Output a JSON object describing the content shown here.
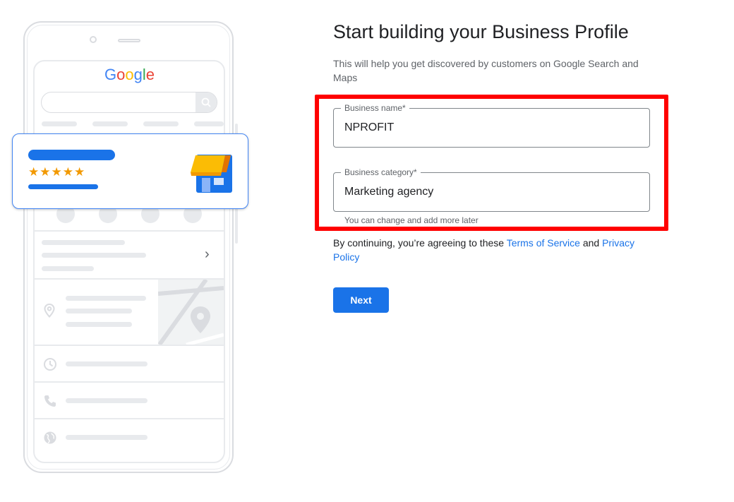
{
  "illustration": {
    "logo_text": "Google",
    "logo_colors": [
      "#4285f4",
      "#ea4335",
      "#fbbc05",
      "#4285f4",
      "#34a853",
      "#ea4335"
    ],
    "stars": "★★★★★",
    "rating_stars": 5,
    "chevron": "›"
  },
  "form": {
    "title": "Start building your Business Profile",
    "subtitle": "This will help you get discovered by customers on Google Search and Maps",
    "business_name": {
      "label": "Business name*",
      "value": "NPROFIT"
    },
    "business_category": {
      "label": "Business category*",
      "value": "Marketing agency",
      "helper": "You can change and add more later"
    },
    "terms": {
      "prefix": "By continuing, you’re agreeing to these ",
      "tos_link": "Terms of Service",
      "and": " and ",
      "privacy_link": "Privacy Policy"
    },
    "next_label": "Next"
  },
  "colors": {
    "accent": "#1a73e8",
    "highlight": "#ff0000",
    "star": "#f29900"
  }
}
